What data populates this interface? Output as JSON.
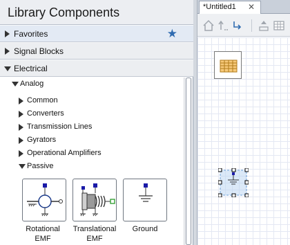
{
  "library": {
    "title": "Library Components",
    "categories": [
      {
        "label": "Favorites",
        "expanded": false
      },
      {
        "label": "Signal Blocks",
        "expanded": false
      },
      {
        "label": "Electrical",
        "expanded": true
      }
    ],
    "favorite_icon": "star-icon",
    "tree": {
      "analog": "Analog",
      "items": [
        "Common",
        "Converters",
        "Transmission Lines",
        "Gyrators",
        "Operational Amplifiers"
      ],
      "passive": "Passive"
    },
    "blocks": [
      {
        "label_line1": "Rotational",
        "label_line2": "EMF",
        "icon": "rotational-emf-icon"
      },
      {
        "label_line1": "Translational",
        "label_line2": "EMF",
        "icon": "translational-emf-icon"
      },
      {
        "label_line1": "Ground",
        "label_line2": "",
        "icon": "ground-icon"
      }
    ]
  },
  "editor": {
    "tab_title": "*Untitled1",
    "tab_close": "✕",
    "toolbar_icons": [
      "home-icon",
      "step-up-icon",
      "step-into-icon",
      "upload-icon",
      "grid-icon"
    ]
  },
  "colors": {
    "accent": "#2f6bb0",
    "selection": "#b8d3f2",
    "port": "#1a1aa8",
    "port_green": "#2a9a2a",
    "canvas_grid": "#e4e8f3",
    "block_border": "#6f7680"
  }
}
